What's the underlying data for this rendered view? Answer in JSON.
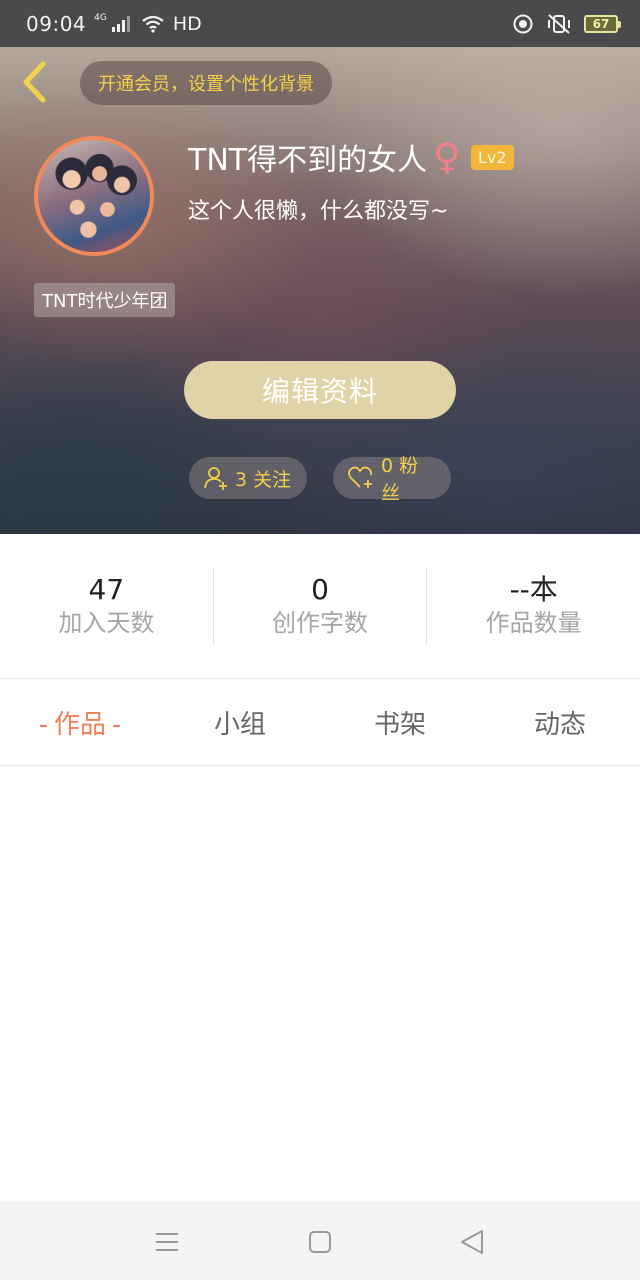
{
  "status_bar": {
    "time": "09:04",
    "network": "4G",
    "hd_label": "HD",
    "battery": "67"
  },
  "header": {
    "vip_promo": "开通会员，设置个性化背景",
    "user_name": "TNT得不到的女人",
    "gender_symbol": "♀",
    "level": "Lv2",
    "bio": "这个人很懒，什么都没写~",
    "group_tag": "TNT时代少年团",
    "edit_profile_label": "编辑资料",
    "follow_label": "3 关注",
    "fans_label": "0 粉丝"
  },
  "stats": [
    {
      "value": "47",
      "label": "加入天数"
    },
    {
      "value": "0",
      "label": "创作字数"
    },
    {
      "value": "--本",
      "label": "作品数量"
    }
  ],
  "tabs": {
    "active_prefix": "-",
    "active_suffix": "-",
    "items": [
      "作品",
      "小组",
      "书架",
      "动态"
    ]
  },
  "colors": {
    "accent": "#f0805a",
    "gold_text": "#f6d24a",
    "edit_button": "#e1d3a8",
    "level_badge": "#f2b73a",
    "avatar_ring": "#f08a5a"
  },
  "icons": {
    "back": "chevron-left-icon",
    "follow": "add-user-icon",
    "fans": "heart-plus-icon",
    "nav_menu": "menu-icon",
    "nav_home": "square-home-icon",
    "nav_back": "triangle-back-icon"
  }
}
